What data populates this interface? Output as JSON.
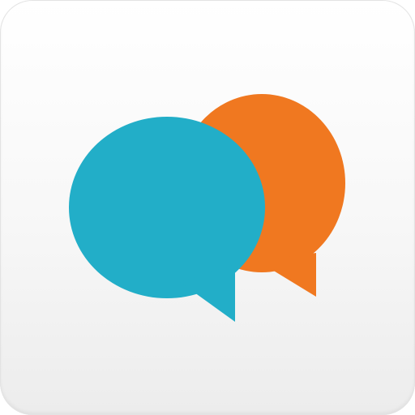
{
  "app_icon": {
    "icon": "chat-bubbles-icon",
    "colors": {
      "tile_top": "#ffffff",
      "tile_bottom": "#ececec",
      "back_bubble": "#f07820",
      "front_bubble": "#22aec8"
    }
  }
}
